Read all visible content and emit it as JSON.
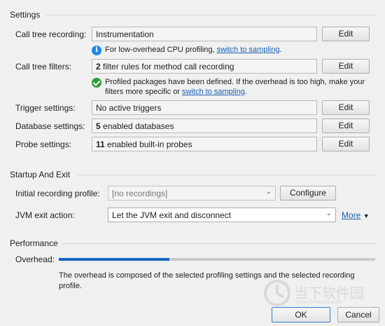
{
  "settings": {
    "title": "Settings",
    "call_tree_recording": {
      "label": "Call tree recording:",
      "value": "Instrumentation",
      "edit": "Edit",
      "info_text": "For low-overhead CPU profiling, ",
      "info_link": "switch to sampling",
      "info_tail": "."
    },
    "call_tree_filters": {
      "label": "Call tree filters:",
      "value_bold": "2",
      "value_rest": " filter rules for method call recording",
      "edit": "Edit",
      "note_line1": "Profiled packages have been defined. If the overhead is too high, make your",
      "note_line2_prefix": "filters more specific or ",
      "note_link": "switch to sampling",
      "note_tail": "."
    },
    "trigger": {
      "label": "Trigger settings:",
      "value": "No active triggers",
      "edit": "Edit"
    },
    "database": {
      "label": "Database settings:",
      "value_bold": "5",
      "value_rest": " enabled databases",
      "edit": "Edit"
    },
    "probe": {
      "label": "Probe settings:",
      "value_bold": "11",
      "value_rest": " enabled built-in probes",
      "edit": "Edit"
    }
  },
  "startup": {
    "title": "Startup And Exit",
    "initial_profile": {
      "label": "Initial recording profile:",
      "value": "[no recordings]",
      "button": "Configure"
    },
    "jvm_exit": {
      "label": "JVM exit action:",
      "value": "Let the JVM exit and disconnect",
      "more": "More"
    }
  },
  "performance": {
    "title": "Performance",
    "overhead_label": "Overhead:",
    "overhead_fraction": 0.35,
    "description_line1": "The overhead is composed of the selected profiling settings and the selected recording",
    "description_line2": "profile."
  },
  "buttons": {
    "ok": "OK",
    "cancel": "Cancel"
  },
  "watermark": {
    "text": "当下软件园",
    "sub": "www.downxia.com"
  },
  "colors": {
    "accent": "#1666c5",
    "link": "#1a5fb4",
    "info": "#1e88e5",
    "success": "#2e9e3a"
  }
}
